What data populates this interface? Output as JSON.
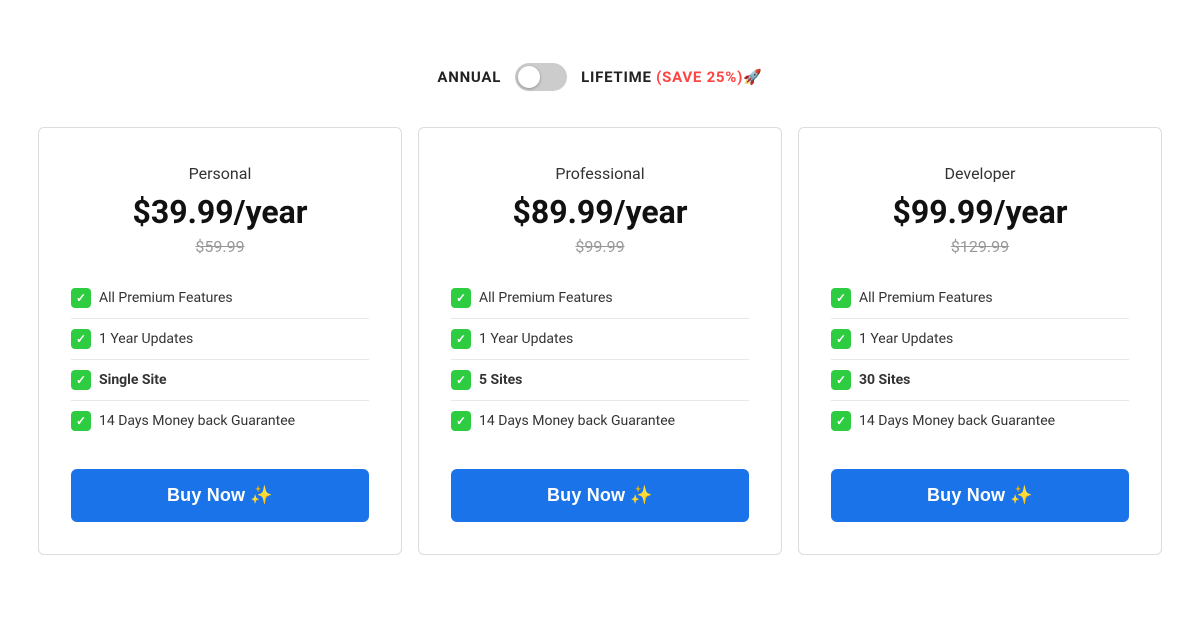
{
  "toggle": {
    "annual_label": "ANNUAL",
    "lifetime_label": "LIFETIME",
    "save_badge": "(SAVE 25%)🚀"
  },
  "plans": [
    {
      "name": "Personal",
      "price": "$39.99/year",
      "original_price": "$59.99",
      "features": [
        {
          "text": "All Premium Features",
          "bold": false
        },
        {
          "text": "1 Year Updates",
          "bold": false
        },
        {
          "text": "Single Site",
          "bold": true
        },
        {
          "text": "14 Days Money back Guarantee",
          "bold": false
        }
      ],
      "button_label": "Buy Now ✨"
    },
    {
      "name": "Professional",
      "price": "$89.99/year",
      "original_price": "$99.99",
      "features": [
        {
          "text": "All Premium Features",
          "bold": false
        },
        {
          "text": "1 Year Updates",
          "bold": false
        },
        {
          "text": "5 Sites",
          "bold": true
        },
        {
          "text": "14 Days Money back Guarantee",
          "bold": false
        }
      ],
      "button_label": "Buy Now ✨"
    },
    {
      "name": "Developer",
      "price": "$99.99/year",
      "original_price": "$129.99",
      "features": [
        {
          "text": "All Premium Features",
          "bold": false
        },
        {
          "text": "1 Year Updates",
          "bold": false
        },
        {
          "text": "30 Sites",
          "bold": true
        },
        {
          "text": "14 Days Money back Guarantee",
          "bold": false
        }
      ],
      "button_label": "Buy Now ✨"
    }
  ],
  "colors": {
    "accent_blue": "#1a73e8",
    "check_green": "#2ecc40",
    "save_red": "#ff4444"
  }
}
